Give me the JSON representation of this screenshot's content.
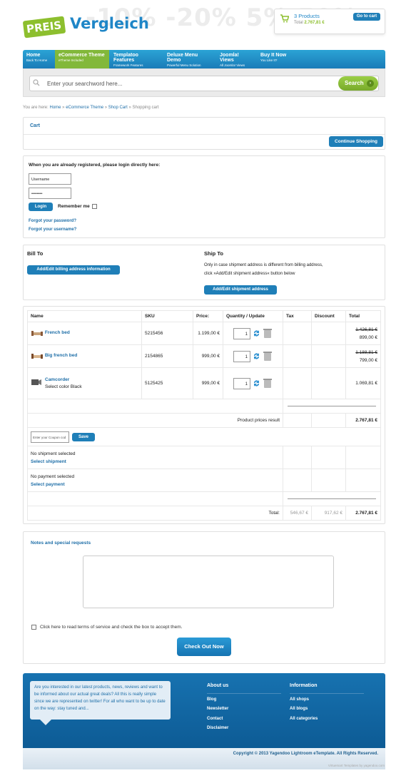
{
  "header": {
    "logo_tag": "PREIS",
    "logo_word": "Vergleich",
    "logo_bg": "-10% -20% 5% 50%",
    "cart_count": "3 Products",
    "cart_total_label": "Total",
    "cart_total_value": "2.767,81 €",
    "goto_cart": "Go to cart"
  },
  "nav": [
    {
      "title": "Home",
      "sub": "Back To Home"
    },
    {
      "title": "eCommerce Theme",
      "sub": "eTheme Included"
    },
    {
      "title": "Templatoo Features",
      "sub": "Framework Features"
    },
    {
      "title": "Deluxe Menu Demo",
      "sub": "Powerful Menu Solution"
    },
    {
      "title": "Joomla! Views",
      "sub": "All Joomla! Views"
    },
    {
      "title": "Buy It Now",
      "sub": "You Like It?"
    }
  ],
  "search": {
    "placeholder": "Enter your searchword here...",
    "button": "Search"
  },
  "breadcrumb": {
    "prefix": "You are here:",
    "home": "Home",
    "theme": "eCommerce Theme",
    "shopcart": "Shop Cart",
    "current": "Shopping cart",
    "sep": "»"
  },
  "cart_panel": {
    "title": "Cart",
    "continue": "Continue Shopping"
  },
  "login": {
    "heading": "When you are already registered, please login directly here:",
    "username": "Username",
    "password": "••••••••",
    "button": "Login",
    "remember": "Remember me",
    "forgot_password": "Forgot your password?",
    "forgot_username": "Forgot your username?"
  },
  "address": {
    "bill_to": "Bill To",
    "bill_button": "Add/Edit billing address information",
    "ship_to": "Ship To",
    "ship_text_1": "Only in case shipment address is different from billing address,",
    "ship_text_2": "click »Add/Edit shipment address« button below",
    "ship_button": "Add/Edit shipment address"
  },
  "table": {
    "headers": {
      "name": "Name",
      "sku": "SKU",
      "price": "Price:",
      "qty": "Quantity / Update",
      "tax": "Tax",
      "discount": "Discount",
      "total": "Total"
    },
    "rows": [
      {
        "name": "French bed",
        "sub": "",
        "sku": "5215456",
        "price": "1.199,00 €",
        "qty": "1",
        "old_total": "1.426,81 €",
        "total": "899,00 €"
      },
      {
        "name": "Big french bed",
        "sub": "",
        "sku": "2154865",
        "price": "999,00 €",
        "qty": "1",
        "old_total": "1.188,81 €",
        "total": "799,00 €"
      },
      {
        "name": "Camcorder",
        "sub": "Select color Black",
        "sku": "5125425",
        "price": "999,00 €",
        "qty": "1",
        "old_total": "",
        "total": "1.069,81 €"
      }
    ],
    "prices_result_label": "Product prices result",
    "prices_result_value": "2.767,81 €",
    "coupon_placeholder": "Enter your Coupon cod",
    "coupon_button": "Save",
    "shipment_status": "No shipment selected",
    "select_shipment": "Select shipment",
    "payment_status": "No payment selected",
    "select_payment": "Select payment",
    "total_label": "Total:",
    "total_tax": "546,67 €",
    "total_discount": "917,62 €",
    "total_value": "2.767,81 €"
  },
  "notes": {
    "heading": "Notes and special requests",
    "terms": "Click here to read terms of service and check the box to accept them.",
    "checkout": "Check Out Now"
  },
  "footer": {
    "bubble": "Are you interested in our latest products, news, reviews and want to be informed about our actual great deals? All this is really simple since we are represented on twitter! For all who want to be up to date on the way: stay tuned and...",
    "about_heading": "About us",
    "about_items": [
      "Blog",
      "Newsletter",
      "Contact",
      "Disclaimer"
    ],
    "info_heading": "Information",
    "info_items": [
      "All shops",
      "All blogs",
      "All categories"
    ],
    "copyright": "Copyright © 2013 Yagendoo Lightroom eTemplate. All Rights Reserved.",
    "credit": "Virtuemart Templates by yagendoo.com"
  },
  "colors": {
    "accent": "#1f7fb8",
    "green": "#8dbf2e"
  }
}
